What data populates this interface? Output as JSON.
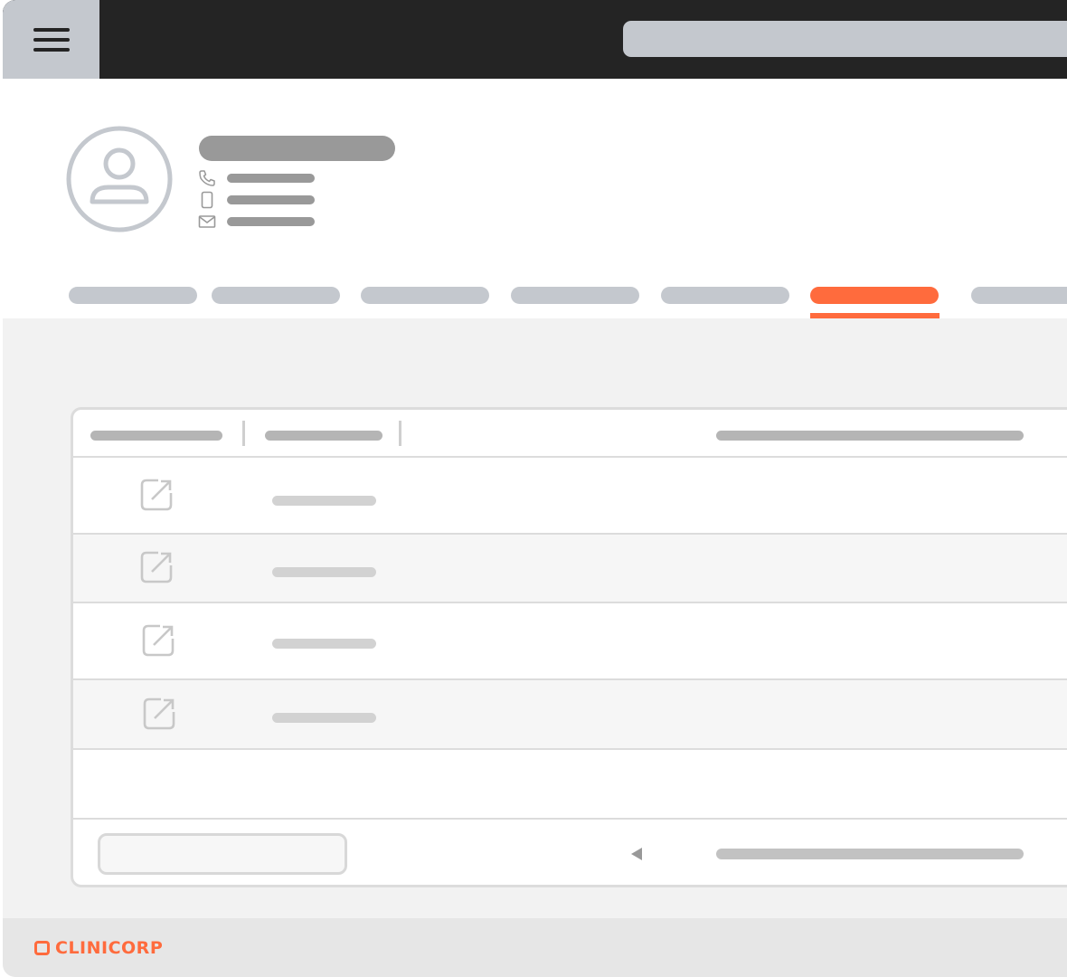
{
  "app": {
    "brand_name": "CLINICORP",
    "accent_color": "#ff6b3d",
    "topbar_color": "#242424",
    "placeholder_color": "#c4c8ce"
  },
  "topbar": {
    "menu_icon": "hamburger-icon",
    "search_placeholder": ""
  },
  "patient": {
    "avatar_icon": "user-avatar-icon",
    "contact_icons": [
      "phone-icon",
      "mobile-icon",
      "mail-icon"
    ]
  },
  "tabs": {
    "count": 7,
    "active_index": 5
  },
  "table": {
    "row_action_icon": "external-link-icon",
    "pagination_icon": "chevron-left-icon"
  }
}
